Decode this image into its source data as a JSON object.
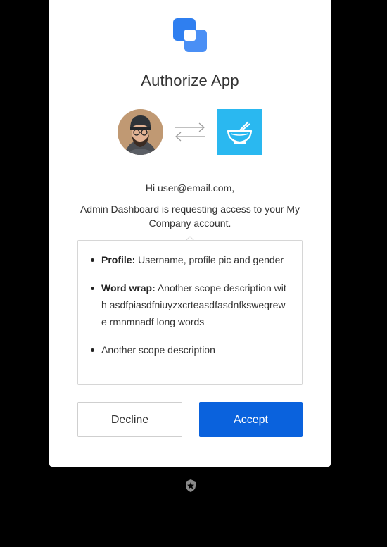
{
  "title": "Authorize App",
  "greeting": "Hi user@email.com,",
  "request_message": "Admin Dashboard is requesting access to your My Company account.",
  "scopes": [
    {
      "name": "Profile:",
      "description": "Username, profile pic and gender"
    },
    {
      "name": "Word wrap:",
      "description": "Another scope description with asdfpiasdfniuyzxcrteasdfasdnfksweqrewe rmnmnadf long words"
    },
    {
      "name": "",
      "description": "Another scope description"
    }
  ],
  "buttons": {
    "decline_label": "Decline",
    "accept_label": "Accept"
  },
  "icons": {
    "app_logo": "overlapping-squares-logo",
    "transfer": "swap-arrows-icon",
    "client_app": "bowl-icon",
    "footer": "shield-star-logo"
  },
  "colors": {
    "accent": "#0a62dd",
    "logo": "#2f7ff0",
    "app_tile": "#2ab8f0",
    "background": "#000000"
  }
}
